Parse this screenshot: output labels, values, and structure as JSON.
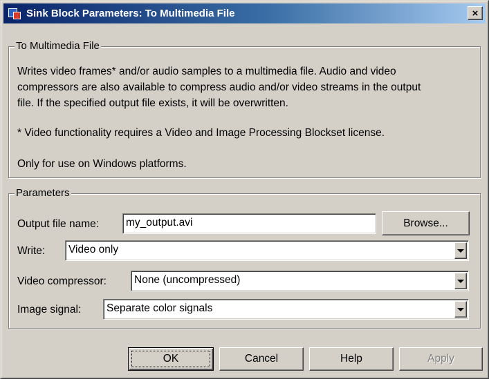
{
  "window": {
    "title": "Sink Block Parameters: To Multimedia File",
    "close_glyph": "×"
  },
  "description_group": {
    "label": "To Multimedia File",
    "lines": [
      "Writes video frames* and/or audio samples to a multimedia file.  Audio and video",
      "compressors are also available to compress audio and/or video streams in the output",
      "file.  If the specified output file exists, it will be overwritten."
    ],
    "note": "* Video functionality requires a Video and Image Processing Blockset license.",
    "platform": "Only for use on Windows platforms."
  },
  "parameters_group": {
    "label": "Parameters",
    "output_file": {
      "label": "Output file name:",
      "value": "my_output.avi",
      "browse_label": "Browse..."
    },
    "write": {
      "label": "Write:",
      "value": "Video only"
    },
    "video_compressor": {
      "label": "Video compressor:",
      "value": "None (uncompressed)"
    },
    "image_signal": {
      "label": "Image signal:",
      "value": "Separate color signals"
    }
  },
  "buttons": {
    "ok": "OK",
    "cancel": "Cancel",
    "help": "Help",
    "apply": "Apply"
  },
  "icons": {
    "app": "simulink-block-icon",
    "close": "close-icon",
    "dropdown": "chevron-down-icon"
  }
}
